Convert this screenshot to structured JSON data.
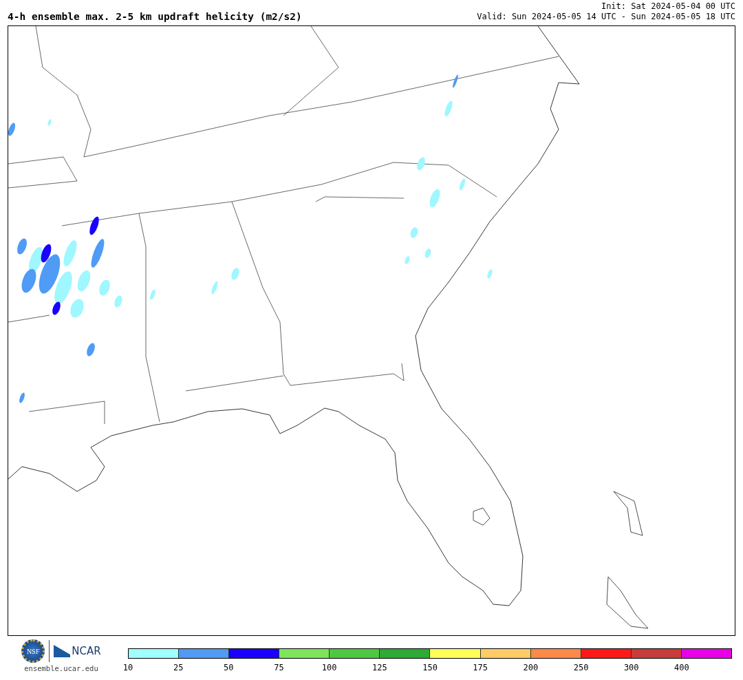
{
  "title": "4-h ensemble max. 2-5 km updraft helicity (m2/s2)",
  "init": "Init: Sat 2024-05-04 00 UTC",
  "valid": "Valid: Sun 2024-05-05 14 UTC - Sun 2024-05-05 18 UTC",
  "logos": {
    "nsf": "NSF",
    "ncar": "NCAR",
    "url": "ensemble.ucar.edu"
  },
  "colorbar": [
    {
      "color": "#a0ffff",
      "label": "10"
    },
    {
      "color": "#4f9bf5",
      "label": "25"
    },
    {
      "color": "#1a00ff",
      "label": "50"
    },
    {
      "color": "#7ee55a",
      "label": "75"
    },
    {
      "color": "#4ec841",
      "label": "100"
    },
    {
      "color": "#2dab35",
      "label": "125"
    },
    {
      "color": "#ffff5a",
      "label": "150"
    },
    {
      "color": "#ffcb66",
      "label": "175"
    },
    {
      "color": "#ff8a47",
      "label": "200"
    },
    {
      "color": "#ff1a1a",
      "label": "250"
    },
    {
      "color": "#c83c3c",
      "label": "300"
    },
    {
      "color": "#e800e8",
      "label": "400"
    }
  ]
}
